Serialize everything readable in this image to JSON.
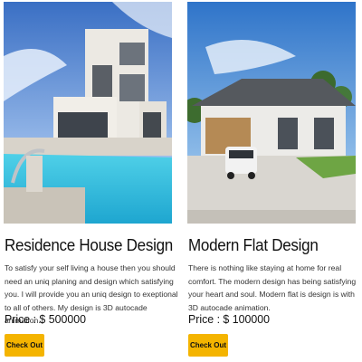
{
  "products": [
    {
      "title": "Residence House Design",
      "description": "To satisfy your self living a house then you should need an uniq planing and design which satisfying you. I will provide you an uniq design to exeptional to all of others. My design is 3D autocade animation.",
      "price": "Price : $ 500000",
      "button_label": "Check Out",
      "image_icon": "modern-villa-with-pool-image"
    },
    {
      "title": "Modern Flat Design",
      "description": "There is nothing like staying at home for real comfort. The modern design has being satisfying your heart and soul. Modern flat is design is with 3D autocade animation.",
      "price": "Price : $ 100000",
      "button_label": "Check Out",
      "image_icon": "modern-house-with-car-image"
    }
  ],
  "colors": {
    "button_bg": "#f4b400",
    "text": "#111111"
  }
}
